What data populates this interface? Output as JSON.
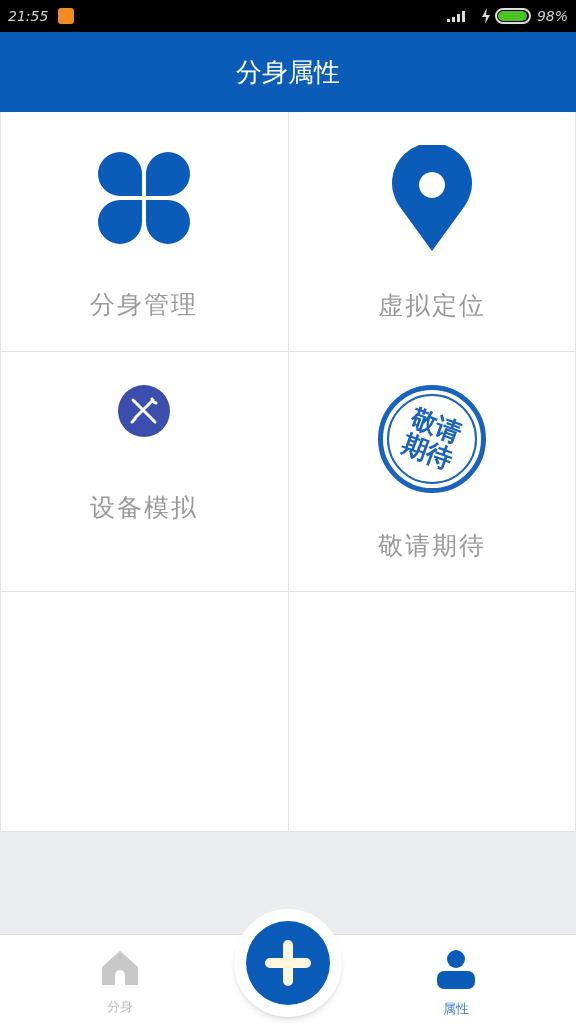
{
  "status_bar": {
    "time": "21:55",
    "battery_text": "98%"
  },
  "header": {
    "title": "分身属性"
  },
  "tiles": [
    {
      "kind": "clover",
      "label": "分身管理"
    },
    {
      "kind": "pin",
      "label": "虚拟定位"
    },
    {
      "kind": "wrench",
      "label": "设备模拟"
    },
    {
      "kind": "stamp",
      "label": "敬请期待",
      "stamp_text": "敬请期待"
    }
  ],
  "bottom_nav": [
    {
      "kind": "home",
      "label": "分身",
      "selected": false
    },
    {
      "kind": "add"
    },
    {
      "kind": "person",
      "label": "属性",
      "selected": true
    }
  ]
}
